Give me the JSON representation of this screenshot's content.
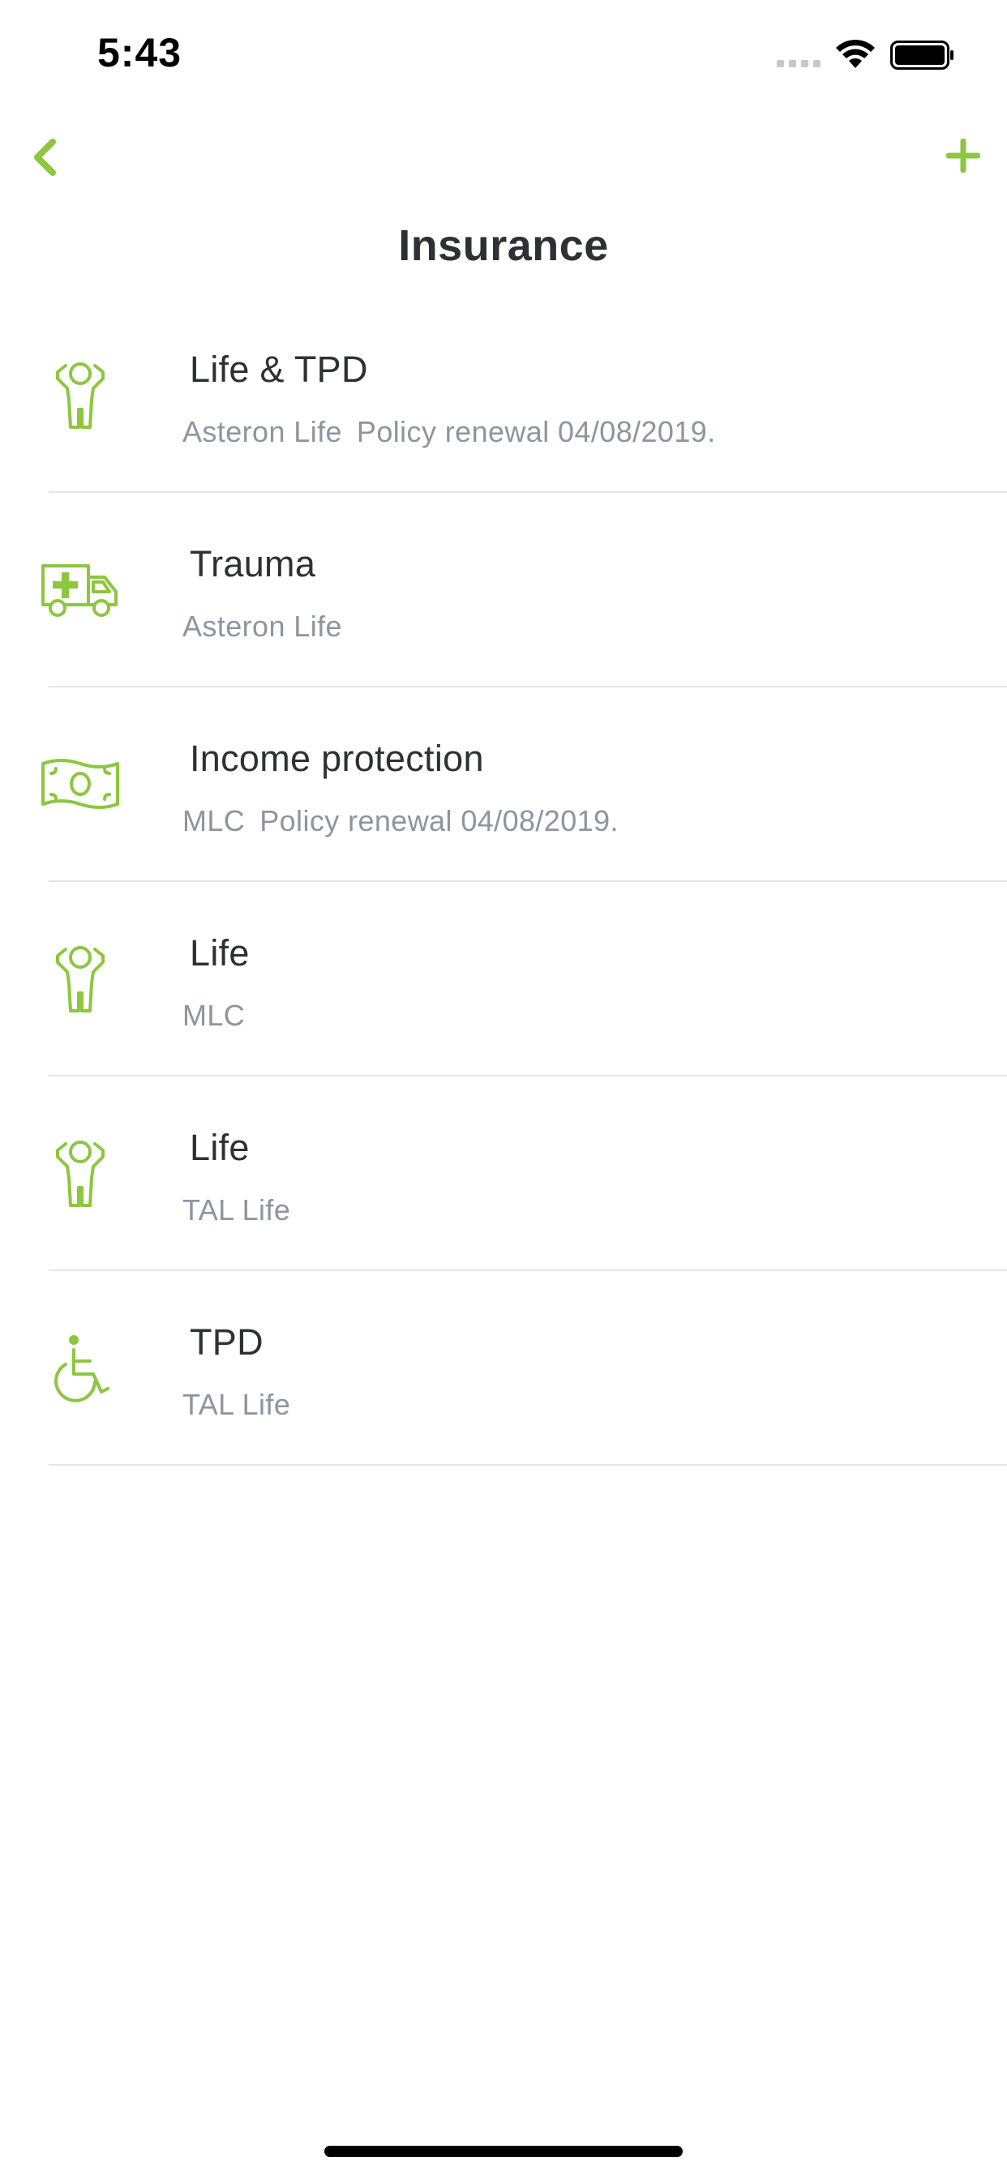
{
  "status_bar": {
    "time": "5:43",
    "icons": [
      "signal-dots-icon",
      "wifi-icon",
      "battery-icon"
    ]
  },
  "nav": {
    "back_icon": "chevron-left-icon",
    "add_icon": "plus-icon",
    "title": "Insurance"
  },
  "colors": {
    "accent": "#8dc63f",
    "title_text": "#2f3033",
    "subtitle_text": "#8c95a0",
    "divider": "#e4e5e7"
  },
  "policies": [
    {
      "icon": "person-icon",
      "title": "Life & TPD",
      "provider": "Asteron Life",
      "renewal": "Policy renewal 04/08/2019."
    },
    {
      "icon": "ambulance-icon",
      "title": "Trauma",
      "provider": "Asteron Life",
      "renewal": ""
    },
    {
      "icon": "banknote-icon",
      "title": "Income protection",
      "provider": "MLC",
      "renewal": "Policy renewal 04/08/2019."
    },
    {
      "icon": "person-icon",
      "title": "Life",
      "provider": "MLC",
      "renewal": ""
    },
    {
      "icon": "person-icon",
      "title": "Life",
      "provider": "TAL Life",
      "renewal": ""
    },
    {
      "icon": "wheelchair-icon",
      "title": "TPD",
      "provider": "TAL Life",
      "renewal": ""
    }
  ]
}
